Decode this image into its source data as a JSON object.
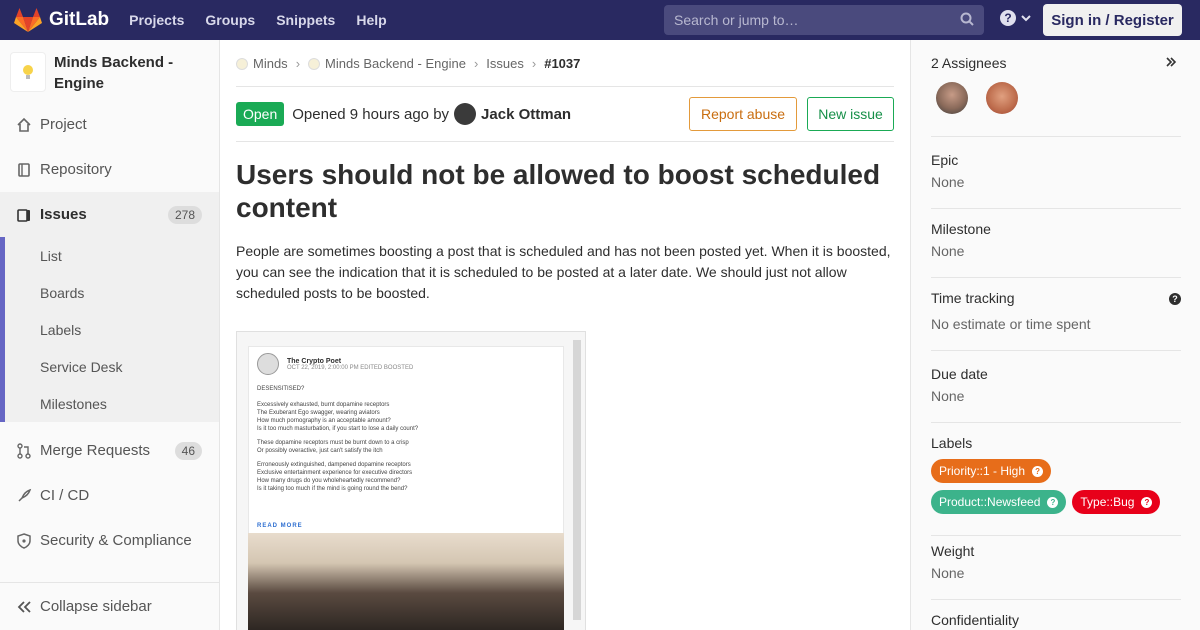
{
  "colors": {
    "navbar": "#292961",
    "open_status": "#1aaa55",
    "label_priority": "#e76d1a",
    "label_product": "#3cb38b",
    "label_type": "#e8001a",
    "active_bar": "#6666c4"
  },
  "navbar": {
    "brand": "GitLab",
    "links": [
      "Projects",
      "Groups",
      "Snippets",
      "Help"
    ],
    "search_placeholder": "Search or jump to…",
    "help_glyph": "?",
    "signin_label": "Sign in / Register"
  },
  "sidebar": {
    "project_name": "Minds Backend - Engine",
    "project_icon": "lightbulb-icon",
    "items": [
      {
        "label": "Project",
        "icon": "home-icon"
      },
      {
        "label": "Repository",
        "icon": "book-icon"
      },
      {
        "label": "Issues",
        "icon": "issues-icon",
        "count": "278"
      },
      {
        "label": "Merge Requests",
        "icon": "merge-request-icon",
        "count": "46"
      },
      {
        "label": "CI / CD",
        "icon": "rocket-icon"
      },
      {
        "label": "Security & Compliance",
        "icon": "shield-icon"
      }
    ],
    "issue_subitems": [
      "List",
      "Boards",
      "Labels",
      "Service Desk",
      "Milestones"
    ],
    "collapse_label": "Collapse sidebar"
  },
  "breadcrumb": {
    "items": [
      "Minds",
      "Minds Backend - Engine",
      "Issues"
    ],
    "current": "#1037"
  },
  "issue": {
    "status": "Open",
    "opened_text": "Opened 9 hours ago by",
    "author": "Jack Ottman",
    "report_abuse_label": "Report abuse",
    "new_issue_label": "New issue",
    "title": "Users should not be allowed to boost scheduled content",
    "description": "People are sometimes boosting a post that is scheduled and has not been posted yet. When it is boosted, you can see the indication that it is scheduled to be posted at a later date. We should just not allow scheduled posts to be boosted."
  },
  "screenshot": {
    "poster_name": "The Crypto Poet",
    "poster_meta": "OCT 22, 2019, 2:00:00 PM  EDITED  BOOSTED",
    "poem_lines": [
      "DESENSITISED?",
      "",
      "Excessively exhausted, burnt dopamine receptors",
      "The Exuberant Ego swagger, wearing aviators",
      "How much pornography is an acceptable amount?",
      "Is it too much masturbation, if you start to lose a daily count?",
      "",
      "These dopamine receptors must be burnt down to a crisp",
      "Or possibly overactive, just can't satisfy the itch",
      "",
      "Erroneously extinguished, dampened dopamine receptors",
      "Exclusive entertainment experience for executive directors",
      "How many drugs do you wholeheartedly recommend?",
      "Is it taking too much if the mind is going round the bend?"
    ],
    "read_more": "READ MORE"
  },
  "right_sidebar": {
    "assignees_label": "2 Assignees",
    "expand_icon": "double-chevron-right-icon",
    "epic_label": "Epic",
    "epic_value": "None",
    "milestone_label": "Milestone",
    "milestone_value": "None",
    "time_label": "Time tracking",
    "time_value": "No estimate or time spent",
    "due_label": "Due date",
    "due_value": "None",
    "labels_label": "Labels",
    "labels": [
      "Priority::1 - High",
      "Product::Newsfeed",
      "Type::Bug"
    ],
    "weight_label": "Weight",
    "weight_value": "None",
    "confidentiality_label": "Confidentiality"
  }
}
